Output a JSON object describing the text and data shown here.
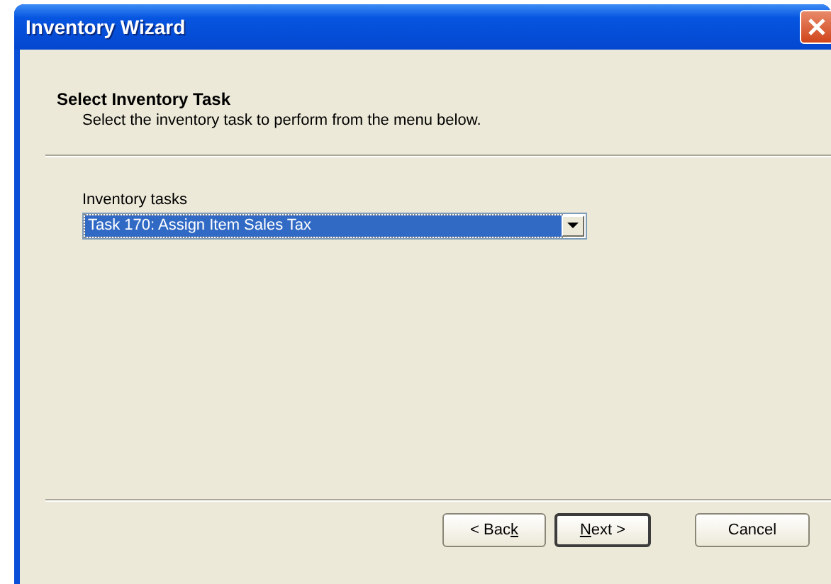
{
  "window": {
    "title": "Inventory Wizard"
  },
  "header": {
    "title": "Select Inventory Task",
    "subtitle": "Select the inventory task to perform from the menu below."
  },
  "task_field": {
    "label": "Inventory tasks",
    "value": "Task 170: Assign Item Sales Tax",
    "focused": true
  },
  "buttons": [
    {
      "before": "< Bac",
      "mnemonic": "k",
      "default": false
    },
    {
      "mnemonic": "N",
      "after": "ext >",
      "default": true
    },
    {
      "before": "Cancel",
      "default": false
    }
  ]
}
